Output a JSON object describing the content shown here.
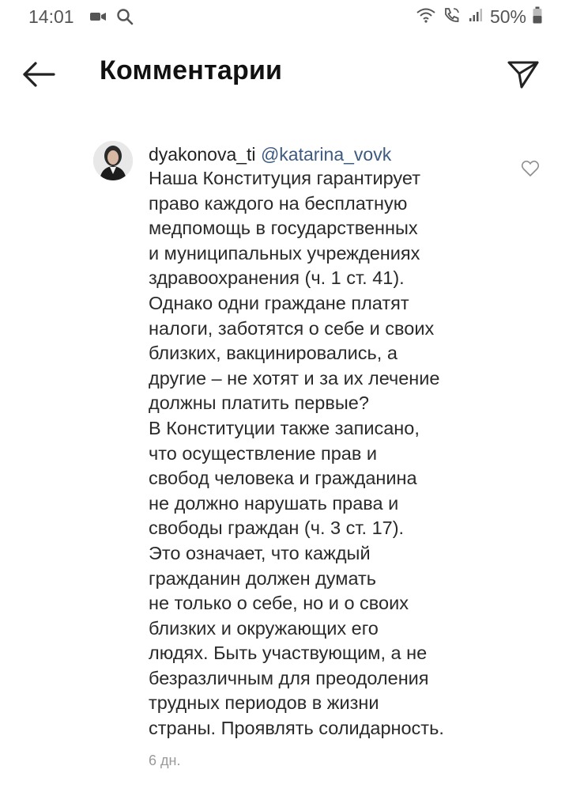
{
  "status_bar": {
    "time": "14:01",
    "left_icons": [
      "video-camera-icon",
      "search-icon"
    ],
    "right_icons": [
      "wifi-icon",
      "call-signal-icon",
      "cell-signal-icon",
      "battery-icon"
    ],
    "battery_percent": "50%"
  },
  "header": {
    "title": "Комментарии",
    "back_icon": "arrow-left-icon",
    "share_icon": "send-icon"
  },
  "comment": {
    "username": "dyakonova_ti",
    "mention": "@katarina_vovk",
    "text": "Наша Конституция гарантирует\nправо каждого на бесплатную\nмедпомощь в государственных\nи муниципальных учреждениях\nздравоохранения (ч. 1 ст. 41).\nОднако одни граждане платят\nналоги, заботятся о себе и своих\nблизких, вакцинировались, а\nдругие – не хотят и за их лечение\nдолжны платить первые?\nВ Конституции также записано,\nчто осуществление прав и\nсвобод человека и гражданина\nне должно нарушать права и\nсвободы граждан (ч. 3 ст. 17).\nЭто означает, что каждый\nгражданин должен думать\nне только о себе, но и о своих\nблизких и окружающих его\nлюдях. Быть участвующим, а не\nбезразличным для преодоления\nтрудных периодов в жизни\nстраны. Проявлять солидарность.",
    "time_ago": "6 дн.",
    "like_icon": "heart-outline-icon"
  }
}
